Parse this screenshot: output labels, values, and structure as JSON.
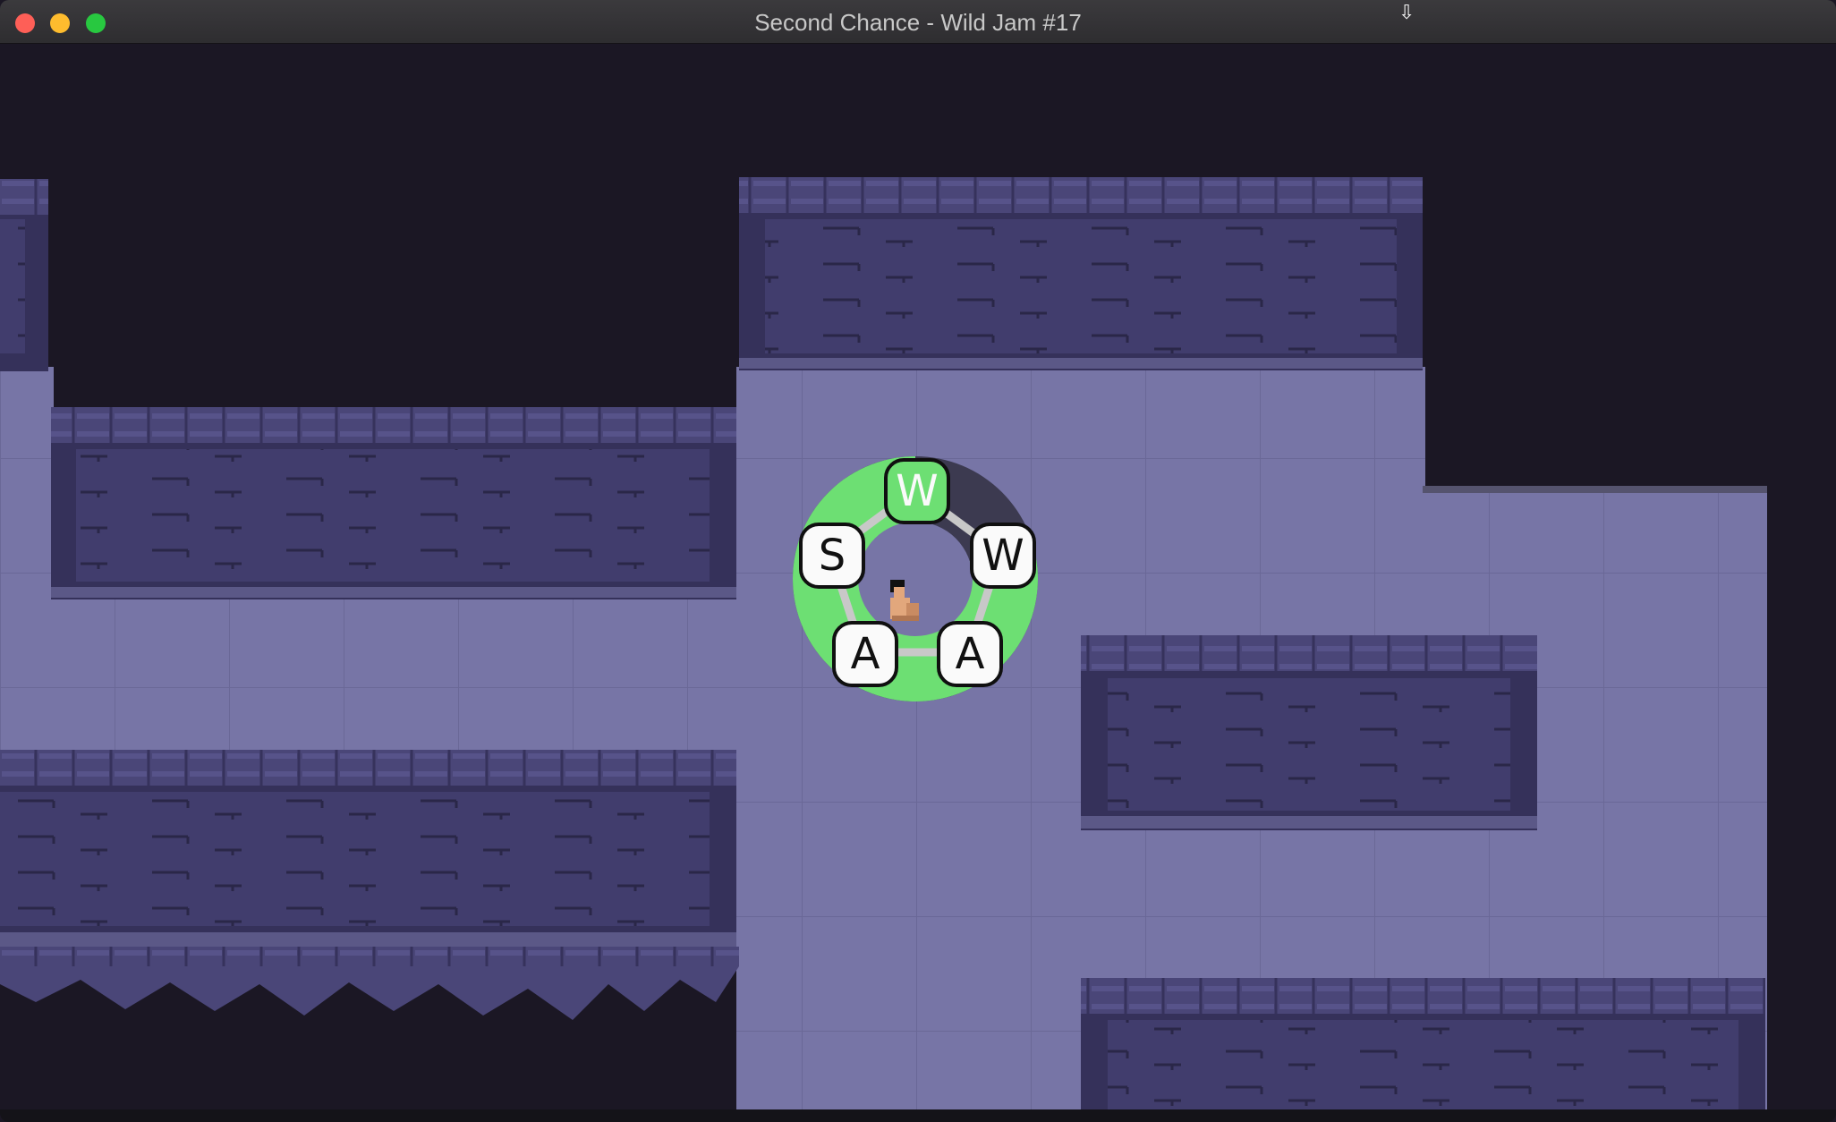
{
  "window": {
    "title": "Second Chance - Wild Jam #17",
    "controls": {
      "close_color": "#fe5f57",
      "minimize_color": "#febc2e",
      "maximize_color": "#28c840"
    },
    "cursor_icon": "resize-arrow-icon"
  },
  "game": {
    "colors": {
      "background": "#1b1724",
      "floor": "#7775a6",
      "floor_grid": "#6a6897",
      "wall_dark": "#3b3762",
      "wall_face": "#413d6d",
      "wall_cap": "#4a4678",
      "wheel_green": "#6ddf73",
      "wheel_dark": "#3c3a50"
    },
    "player": {
      "name": "player-character"
    },
    "combo_wheel": {
      "keys": [
        {
          "label": "W",
          "active": true
        },
        {
          "label": "W",
          "active": false
        },
        {
          "label": "A",
          "active": false
        },
        {
          "label": "A",
          "active": false
        },
        {
          "label": "S",
          "active": false
        }
      ],
      "progress": 0.8
    }
  }
}
